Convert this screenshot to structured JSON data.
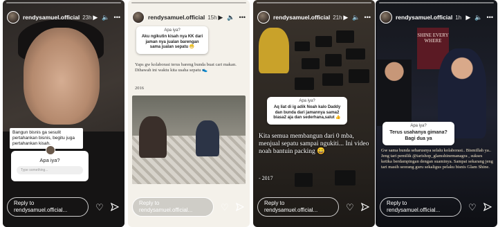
{
  "stories": [
    {
      "username": "rendysamuel.official",
      "time": "23h",
      "caption": "Bangun bisnis ga sesulit pertahankan bisnis, begitu juga pertahankan kisah.",
      "question": "Apa iya?",
      "input_placeholder": "Type something...",
      "reply_placeholder": "Reply to rendysamuel.official..."
    },
    {
      "username": "rendysamuel.official",
      "time": "15h",
      "question_title": "Apa iya?",
      "question_text": "Aku ngikutin kisah nya KK dari jaman nya jualan barengan sama jualan sepatu 😁",
      "body_text": "Yaps gw kolaborasi terus bareng bunda buat cari makan. Dihawah ini waktu kita usaha sepatu 👟",
      "year": "2016",
      "reply_placeholder": "Reply to rendysamuel.official..."
    },
    {
      "username": "rendysamuel.official",
      "time": "21h",
      "question_title": "Apa iya?",
      "question_text": "Aq liat di ig adik Noah kalo Daddy dan bunda dari jamannya sama2 biasa2 aja dan sederhana,salut 👍",
      "body_text": "Kita semua membangun dari 0 mba, menjual sepatu sampai ngukiti... Ini video noah bantuin packing 😄",
      "year": "- 2017",
      "reply_placeholder": "Reply to rendysamuel.official..."
    },
    {
      "username": "rendysamuel.official",
      "time": "1h",
      "poster_text": "SHINE EVERY WHERE",
      "question_title": "Apa iya?",
      "question_text": "Terus usahanya gimana? Bagi dua ya",
      "body_text": "Gw sama bunda seharusnya selalu kolaborasi.. Bismillah ya.. Jeng tari pemilik @tarishop_glamshinemanagra , sukses ketika berdampingan dengan suaminya. Sampai sekarang jeng tari masih seorang guru sekaligus pelaku bisnis Glam Shine.",
      "reply_placeholder": "Reply to rendysamuel.official..."
    }
  ],
  "icons": {
    "play": "play-icon",
    "mute": "volume-icon",
    "more": "more-icon",
    "like": "heart-icon",
    "send": "send-icon"
  }
}
